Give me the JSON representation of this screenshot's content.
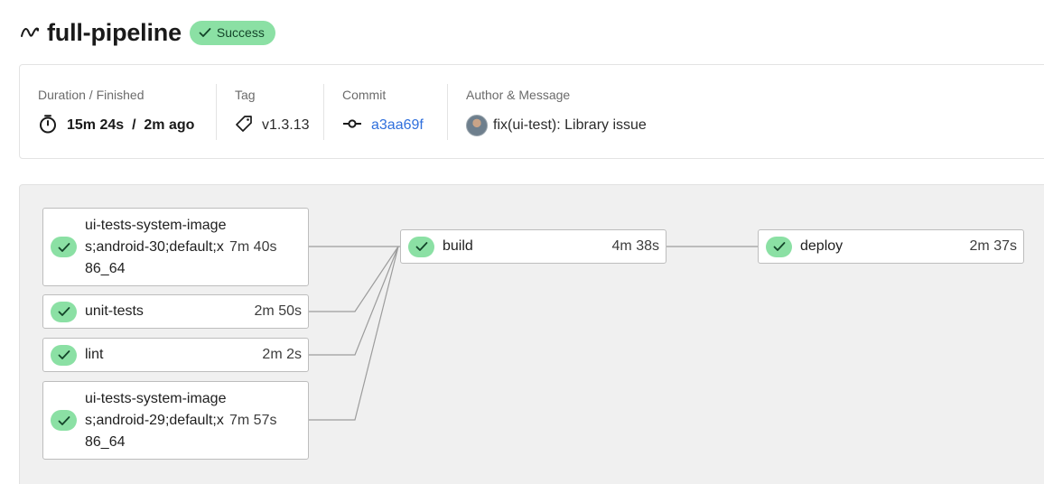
{
  "header": {
    "title": "full-pipeline",
    "status": "Success",
    "icon": "pipeline-icon"
  },
  "info": {
    "duration_label": "Duration / Finished",
    "duration": "15m 24s",
    "separator": "/",
    "finished": "2m ago",
    "tag_label": "Tag",
    "tag": "v1.3.13",
    "commit_label": "Commit",
    "commit": "a3aa69f",
    "author_label": "Author & Message",
    "message": "fix(ui-test): Library issue"
  },
  "stages": {
    "tests": [
      {
        "name": "ui-tests-system-images;android-30;default;x86_64",
        "duration": "7m 40s",
        "status": "success"
      },
      {
        "name": "unit-tests",
        "duration": "2m 50s",
        "status": "success"
      },
      {
        "name": "lint",
        "duration": "2m 2s",
        "status": "success"
      },
      {
        "name": "ui-tests-system-images;android-29;default;x86_64",
        "duration": "7m 57s",
        "status": "success"
      }
    ],
    "build": {
      "name": "build",
      "duration": "4m 38s",
      "status": "success"
    },
    "deploy": {
      "name": "deploy",
      "duration": "2m 37s",
      "status": "success"
    }
  },
  "colors": {
    "success": "#8be0a4",
    "success_text": "#14452a",
    "link": "#2f6fdc",
    "graph_bg": "#f0f0f0"
  }
}
